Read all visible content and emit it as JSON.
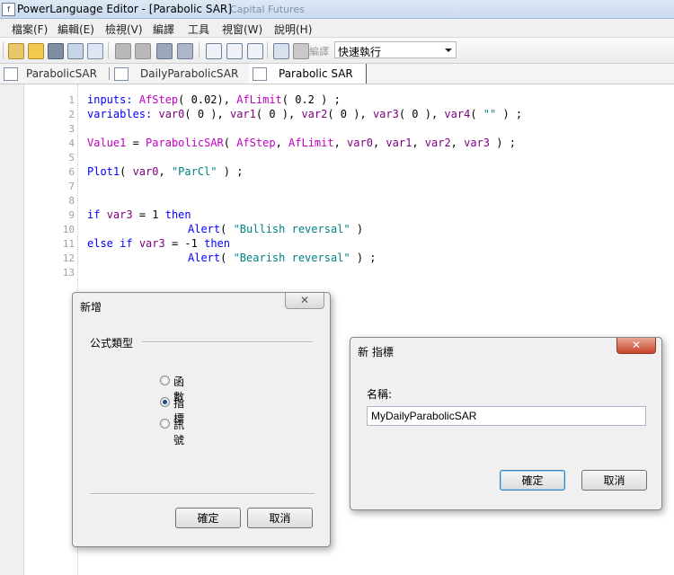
{
  "window": {
    "title": "PowerLanguage Editor - [Parabolic SAR]",
    "title_faded": "Capital Futures",
    "app_icon": "f"
  },
  "menu": [
    "檔案(F)",
    "編輯(E)",
    "檢視(V)",
    "編譯",
    "工具",
    "視窗(W)",
    "說明(H)"
  ],
  "toolbar": {
    "label": "編譯",
    "dropdown_value": "快速執行"
  },
  "tabs": [
    {
      "label": "ParabolicSAR",
      "active": false
    },
    {
      "label": "DailyParabolicSAR",
      "active": false
    },
    {
      "label": "Parabolic SAR",
      "active": true
    }
  ],
  "code_lines": [
    "1",
    "2",
    "3",
    "4",
    "5",
    "6",
    "7",
    "8",
    "9",
    "10",
    "11",
    "12",
    "13"
  ],
  "code": {
    "l1": {
      "a": "inputs:",
      "b": "AfStep",
      "c": "( 0.02), ",
      "d": "AfLimit",
      "e": "( 0.2 ) ;"
    },
    "l2": {
      "a": "variables:",
      "b": "var0",
      "c": "( 0 ), ",
      "d": "var1",
      "e": "( 0 ), ",
      "f": "var2",
      "g": "( 0 ), ",
      "h": "var3",
      "i": "( 0 ), ",
      "j": "var4",
      "k": "( ",
      "l": "\"\"",
      "m": " ) ;"
    },
    "l4": {
      "a": "Value1",
      "b": " = ",
      "c": "ParabolicSAR",
      "d": "( ",
      "e": "AfStep",
      "f": ", ",
      "g": "AfLimit",
      "h": ", ",
      "i": "var0",
      "j": ", ",
      "k": "var1",
      "l": ", ",
      "m": "var2",
      "n": ", ",
      "o": "var3",
      "p": " ) ;"
    },
    "l6": {
      "a": "Plot1",
      "b": "( ",
      "c": "var0",
      "d": ", ",
      "e": "\"ParCl\"",
      "f": " ) ;"
    },
    "l9": {
      "a": "if",
      "b": "var3",
      "c": " = 1 ",
      "d": "then"
    },
    "l10": {
      "a": "Alert",
      "b": "( ",
      "c": "\"Bullish reversal\"",
      "d": " )"
    },
    "l11": {
      "a": "else",
      "b": "if",
      "c": "var3",
      "d": " = -1 ",
      "e": "then"
    },
    "l12": {
      "a": "Alert",
      "b": "( ",
      "c": "\"Bearish reversal\"",
      "d": " ) ;"
    }
  },
  "dialog_new": {
    "title": "新增",
    "close": "✕",
    "group_label": "公式類型",
    "options": [
      {
        "label": "函數",
        "selected": false
      },
      {
        "label": "指標",
        "selected": true
      },
      {
        "label": "訊號",
        "selected": false
      }
    ],
    "ok": "確定",
    "cancel": "取消"
  },
  "dialog_indicator": {
    "title": "新 指標",
    "close": "✕",
    "name_label": "名稱:",
    "name_value": "MyDailyParabolicSAR",
    "ok": "確定",
    "cancel": "取消"
  }
}
